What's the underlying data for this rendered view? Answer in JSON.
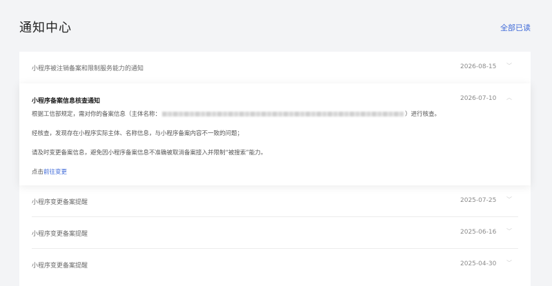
{
  "header": {
    "title": "通知中心",
    "mark_all_read": "全部已读"
  },
  "notifications": [
    {
      "title": "小程序被注销备案和限制服务能力的通知",
      "date": "2026-08-15",
      "expanded": false
    },
    {
      "title": "小程序备案信息核查通知",
      "date": "2026-07-10",
      "expanded": true
    },
    {
      "title": "小程序变更备案提醒",
      "date": "2025-07-25",
      "expanded": false
    },
    {
      "title": "小程序变更备案提醒",
      "date": "2025-06-16",
      "expanded": false
    },
    {
      "title": "小程序变更备案提醒",
      "date": "2025-04-30",
      "expanded": false
    }
  ],
  "detail": {
    "para1_prefix": "根据工信部规定，需对你的备案信息（主体名称：",
    "para1_suffix": "）进行核查。",
    "para2": "经核查，发现存在小程序实际主体、名称信息，与小程序备案内容不一致的问题；",
    "para3": "请及时变更备案信息，避免因小程序备案信息不准确被取消备案接入并限制“被搜索”能力。",
    "action_prefix": "点击",
    "action_link": "前往变更"
  },
  "icons": {
    "collapse": "chevron-down-icon",
    "expand": "chevron-up-icon"
  }
}
